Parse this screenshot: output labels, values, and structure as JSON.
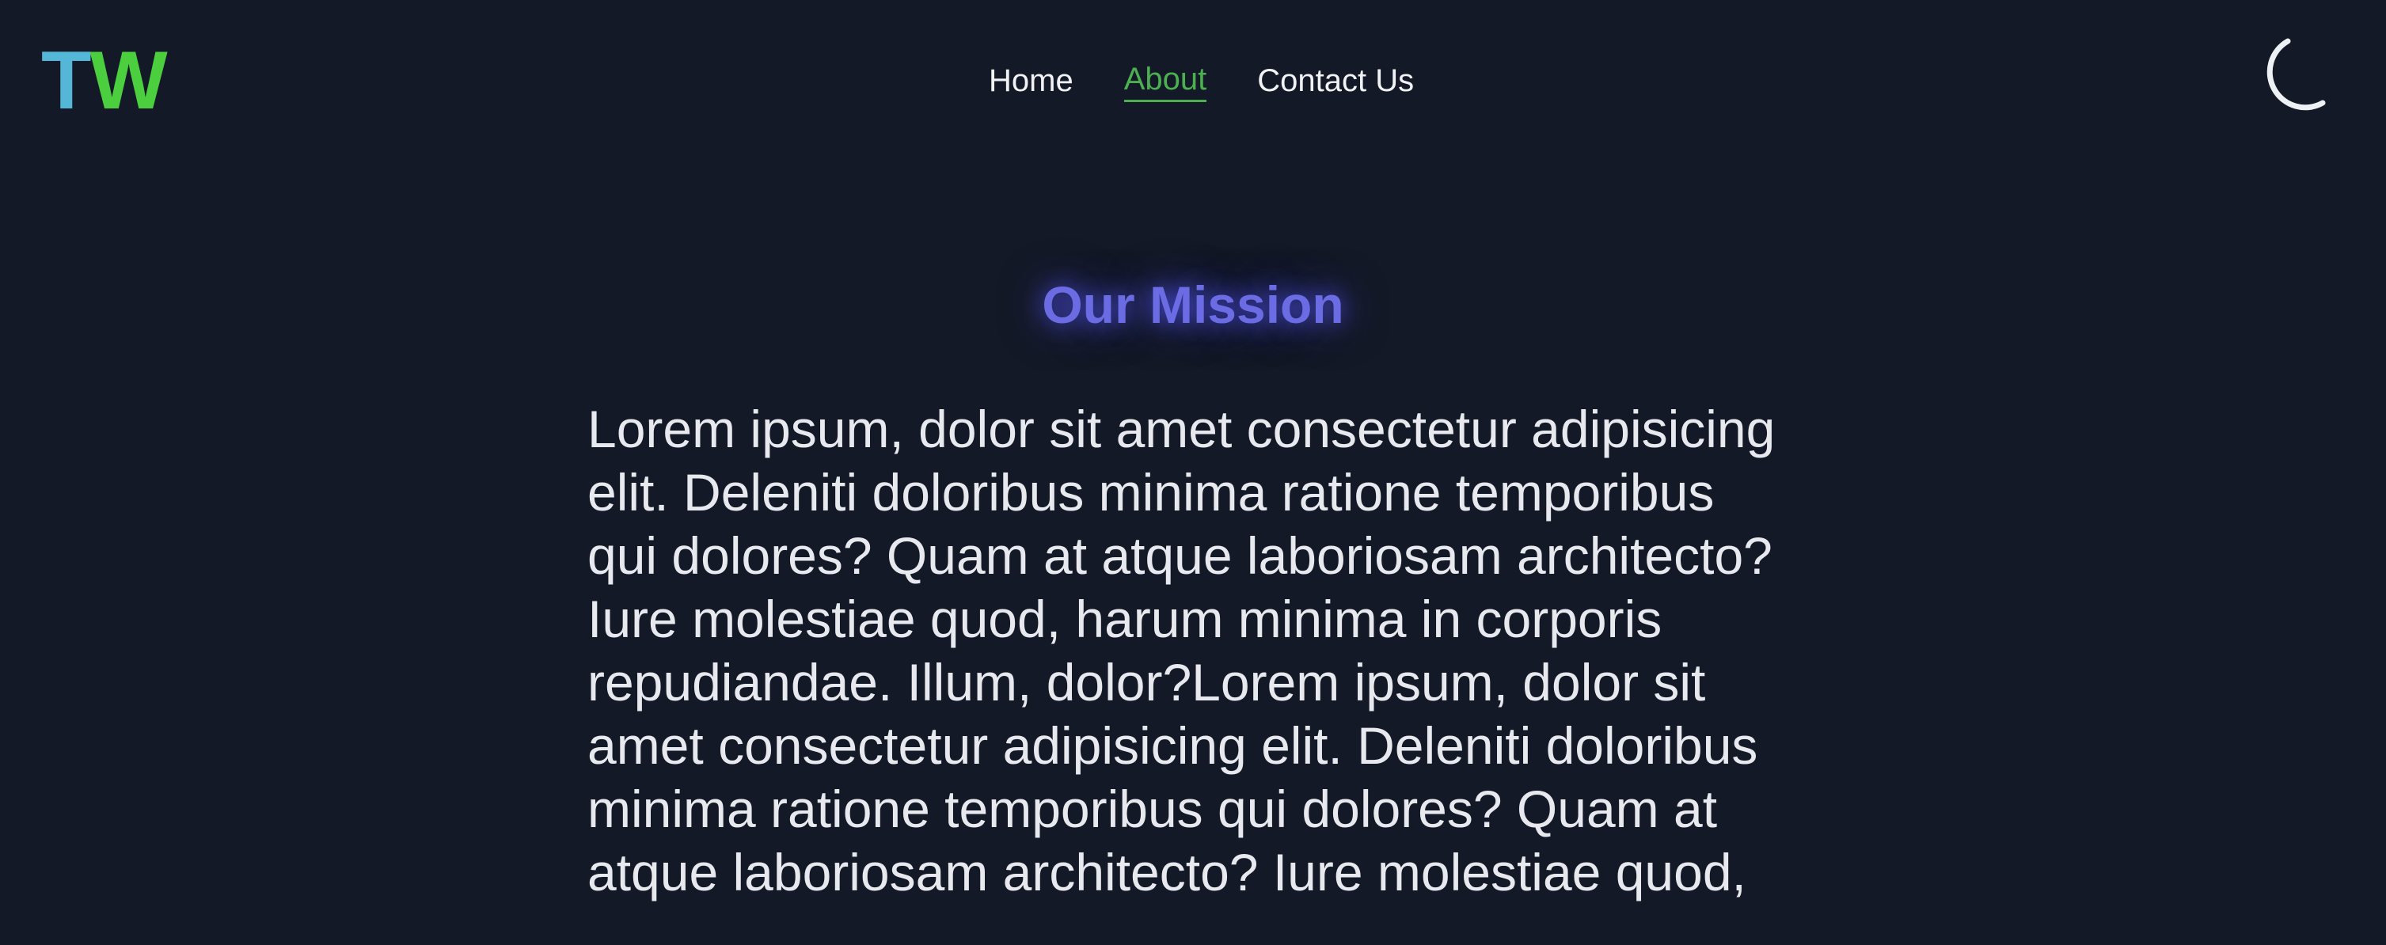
{
  "header": {
    "logo": {
      "part1": "T",
      "part2": "W"
    },
    "nav": [
      {
        "label": "Home"
      },
      {
        "label": "About",
        "active": true
      },
      {
        "label": "Contact Us"
      }
    ],
    "theme_toggle_icon": "moon-icon"
  },
  "main": {
    "title": "Our Mission",
    "text": "Lorem ipsum, dolor sit amet consectetur adipisicing elit. Deleniti doloribus minima ratione temporibus qui dolores? Quam at atque laboriosam architecto? Iure molestiae quod, harum minima in corporis repudiandae. Illum, dolor?Lorem ipsum, dolor sit amet consectetur adipisicing elit. Deleniti doloribus minima ratione temporibus qui dolores? Quam at atque laboriosam architecto? Iure molestiae quod,"
  },
  "colors": {
    "background": "#141927",
    "logo_t": "#55b7d8",
    "logo_w": "#4ccf3f",
    "nav_active": "#4caf50",
    "title": "#6b6be3",
    "text": "#e8e9ee"
  }
}
